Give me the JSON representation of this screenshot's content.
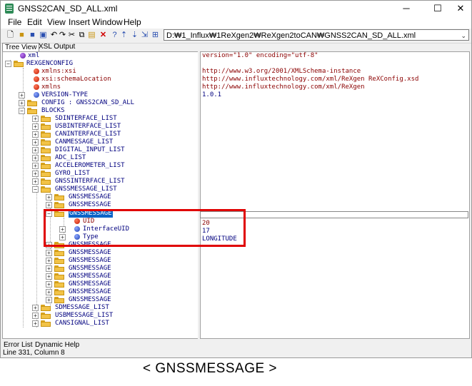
{
  "window": {
    "title": "GNSS2CAN_SD_ALL.xml",
    "controls": {
      "minimize": "─",
      "maximize": "☐",
      "close": "✕"
    }
  },
  "menu": [
    "File",
    "Edit",
    "View",
    "Insert",
    "Window",
    "Help"
  ],
  "toolbar": {
    "icons": [
      "new-file-icon",
      "open-folder-icon",
      "save-icon",
      "save-all-icon",
      "undo-icon",
      "redo-icon",
      "cut-icon",
      "copy-icon",
      "paste-icon",
      "delete-icon",
      "help-icon",
      "insert-before-icon",
      "insert-after-icon",
      "insert-child-icon",
      "insert-attribute-icon"
    ],
    "path": "D:₩1_Influx₩1ReXgen2₩ReXgen2toCAN₩GNSS2CAN_SD_ALL.xml"
  },
  "tabs": {
    "tree_view": "Tree View",
    "xsl_output": "XSL Output"
  },
  "tree": [
    {
      "label": "xml",
      "icon": "purple"
    },
    {
      "label": "REXGENCONFIG",
      "icon": "folder"
    },
    {
      "label": "xmlns:xsi",
      "icon": "red"
    },
    {
      "label": "xsi:schemaLocation",
      "icon": "red"
    },
    {
      "label": "xmlns",
      "icon": "red"
    },
    {
      "label": "VERSION-TYPE",
      "icon": "blue"
    },
    {
      "label": "CONFIG : GNSS2CAN_SD_ALL",
      "icon": "folder"
    },
    {
      "label": "BLOCKS",
      "icon": "folder"
    },
    {
      "label": "SDINTERFACE_LIST",
      "icon": "folder"
    },
    {
      "label": "USBINTERFACE_LIST",
      "icon": "folder"
    },
    {
      "label": "CANINTERFACE_LIST",
      "icon": "folder"
    },
    {
      "label": "CANMESSAGE_LIST",
      "icon": "folder"
    },
    {
      "label": "DIGITAL_INPUT_LIST",
      "icon": "folder"
    },
    {
      "label": "ADC_LIST",
      "icon": "folder"
    },
    {
      "label": "ACCELEROMETER_LIST",
      "icon": "folder"
    },
    {
      "label": "GYRO_LIST",
      "icon": "folder"
    },
    {
      "label": "GNSSINTERFACE_LIST",
      "icon": "folder"
    },
    {
      "label": "GNSSMESSAGE_LIST",
      "icon": "folder"
    },
    {
      "label": "GNSSMESSAGE",
      "icon": "folder"
    },
    {
      "label": "GNSSMESSAGE",
      "icon": "folder"
    },
    {
      "label": "GNSSMESSAGE",
      "icon": "folder"
    },
    {
      "label": "UID",
      "icon": "red"
    },
    {
      "label": "InterfaceUID",
      "icon": "blue"
    },
    {
      "label": "Type",
      "icon": "blue"
    },
    {
      "label": "GNSSMESSAGE",
      "icon": "folder"
    },
    {
      "label": "GNSSMESSAGE",
      "icon": "folder"
    },
    {
      "label": "GNSSMESSAGE",
      "icon": "folder"
    },
    {
      "label": "GNSSMESSAGE",
      "icon": "folder"
    },
    {
      "label": "GNSSMESSAGE",
      "icon": "folder"
    },
    {
      "label": "GNSSMESSAGE",
      "icon": "folder"
    },
    {
      "label": "GNSSMESSAGE",
      "icon": "folder"
    },
    {
      "label": "GNSSMESSAGE",
      "icon": "folder"
    },
    {
      "label": "SDMESSAGE_LIST",
      "icon": "folder"
    },
    {
      "label": "USBMESSAGE_LIST",
      "icon": "folder"
    },
    {
      "label": "CANSIGNAL_LIST",
      "icon": "folder"
    }
  ],
  "values": [
    "version=\"1.0\" encoding=\"utf-8\"",
    "http://www.w3.org/2001/XMLSchema-instance",
    "http://www.influxtechnology.com/xml/ReXgen ReXConfig.xsd",
    "http://www.influxtechnology.com/xml/ReXgen",
    "1.0.1",
    "20",
    "17",
    "LONGITUDE"
  ],
  "bottom_tabs": {
    "error_list": "Error List",
    "dynamic_help": "Dynamic Help"
  },
  "status": "Line 331, Column 8",
  "caption": "< GNSSMESSAGE >",
  "colors": {
    "selection": "#0a64c8",
    "highlight_box": "#e00000",
    "tag_text": "#00007f",
    "attr_text": "#8b0000"
  }
}
